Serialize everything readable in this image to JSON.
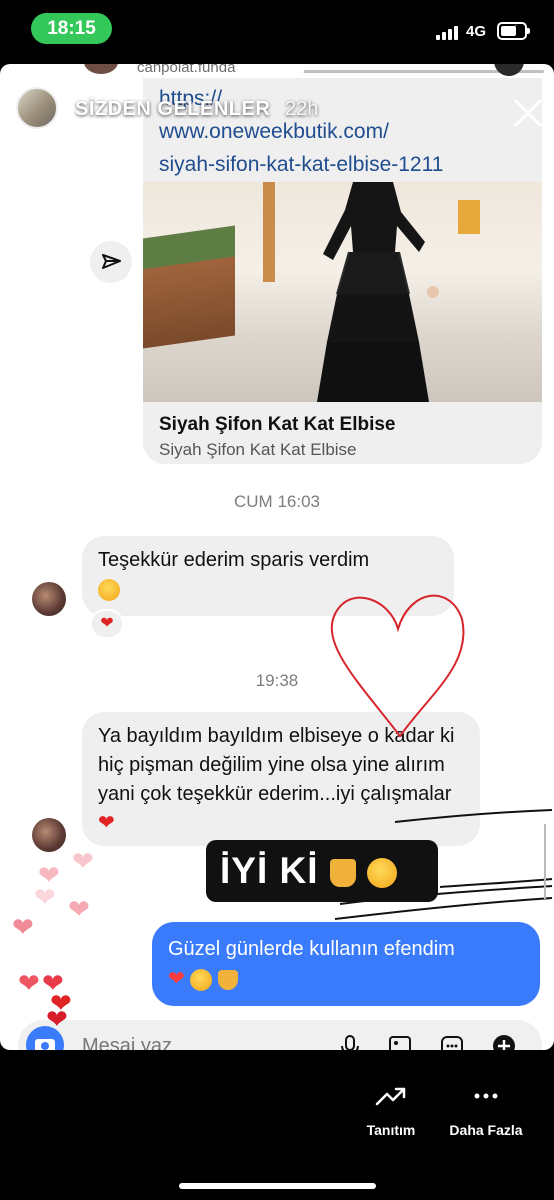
{
  "status_bar": {
    "time": "18:15",
    "network": "4G",
    "time_pill_color": "#34c759"
  },
  "story": {
    "title": "SİZDEN GELENLER",
    "age": "22h",
    "progress": 0.55,
    "icons": {
      "close": "close-icon",
      "share": "send-icon"
    }
  },
  "conversation": {
    "partner_name": "canpolat.funda",
    "link_card": {
      "url_line1": "https://",
      "url_line2": "www.oneweekbutik.com/",
      "url_line3": "siyah-sifon-kat-kat-elbise-1211",
      "title": "Siyah Şifon Kat Kat Elbise",
      "subtitle": "Siyah Şifon Kat Kat Elbise"
    },
    "timestamp1": "CUM 16:03",
    "message1": "Teşekkür ederim sparis verdim",
    "timestamp2": "19:38",
    "message2": "Ya bayıldım bayıldım elbiseye o kadar ki hiç pişman değilim yine olsa yine alırım yani çok teşekkür ederim...iyi çalışmalar",
    "sent_message": "Güzel günlerde kullanın efendim",
    "composer_placeholder": "Mesaj yaz"
  },
  "sticker_text": "İYİ Kİ",
  "bottom_bar": {
    "promote_label": "Tanıtım",
    "more_label": "Daha Fazla"
  },
  "colors": {
    "accent_blue": "#3a7bfb",
    "link_blue": "#1f4d8f",
    "heart_red": "#e02424",
    "bubble_gray": "#efefef"
  }
}
